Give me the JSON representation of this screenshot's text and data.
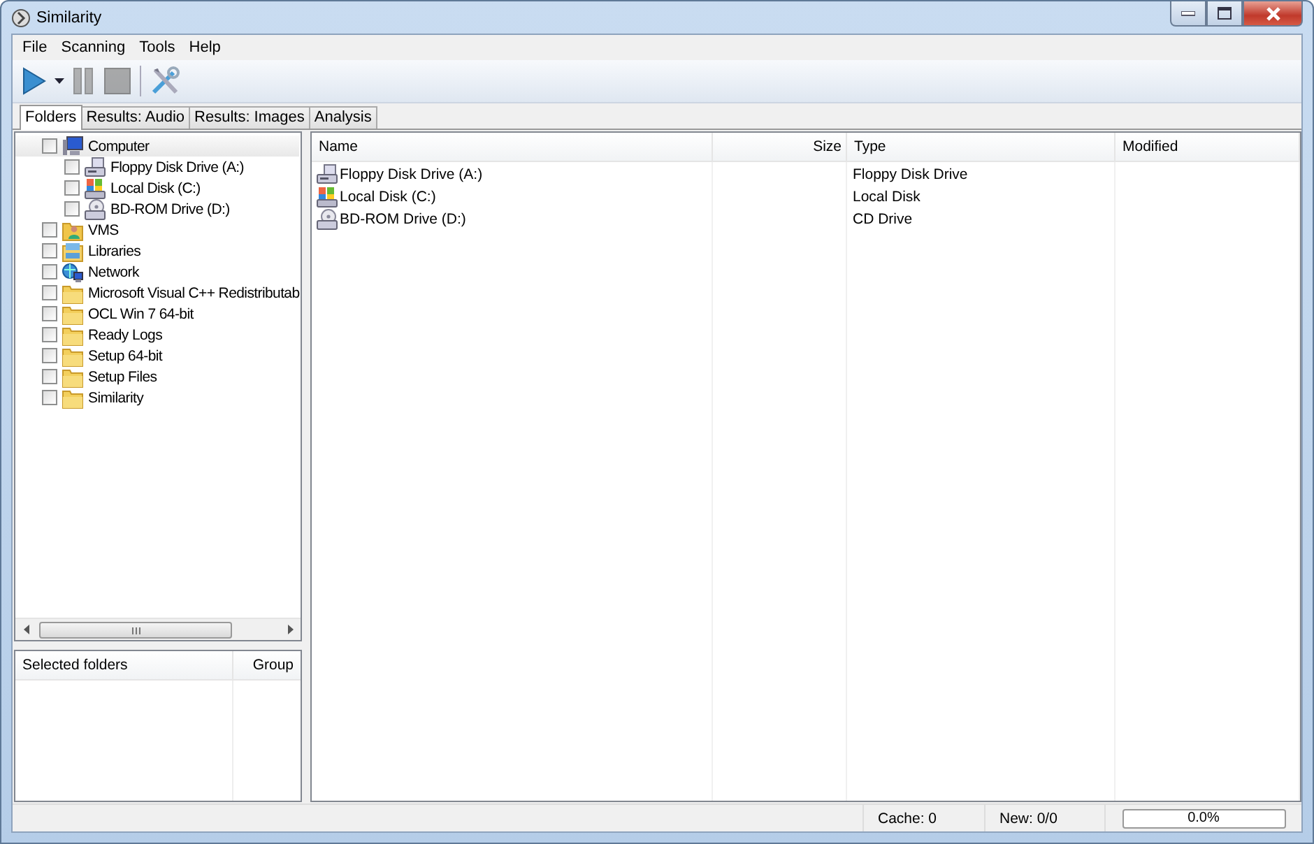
{
  "window": {
    "title": "Similarity"
  },
  "menu": [
    "File",
    "Scanning",
    "Tools",
    "Help"
  ],
  "toolbar": [
    {
      "kind": "play",
      "disabled": false
    },
    {
      "kind": "dropdown",
      "disabled": false
    },
    {
      "kind": "pause",
      "disabled": true
    },
    {
      "kind": "stop",
      "disabled": true
    },
    {
      "kind": "tools",
      "disabled": false
    }
  ],
  "tabs": [
    {
      "label": "Folders",
      "selected": true
    },
    {
      "label": "Results: Audio",
      "selected": false
    },
    {
      "label": "Results: Images",
      "selected": false
    },
    {
      "label": "Analysis",
      "selected": false
    }
  ],
  "tree": {
    "items": [
      {
        "label": "Computer",
        "kind": "computer",
        "checked": false,
        "selected": true,
        "children": [
          {
            "label": "Floppy Disk Drive (A:)",
            "kind": "floppy",
            "checked": false,
            "selected": false
          },
          {
            "label": "Local Disk (C:)",
            "kind": "disk",
            "checked": false,
            "selected": false
          },
          {
            "label": "BD-ROM Drive (D:)",
            "kind": "optical",
            "checked": false,
            "selected": false
          }
        ]
      },
      {
        "label": "VMS",
        "kind": "user-folder",
        "checked": false,
        "selected": false
      },
      {
        "label": "Libraries",
        "kind": "library",
        "checked": false,
        "selected": false
      },
      {
        "label": "Network",
        "kind": "network",
        "checked": false,
        "selected": false
      },
      {
        "label": "Microsoft Visual C++ Redistributab",
        "kind": "folder",
        "checked": false,
        "selected": false
      },
      {
        "label": "OCL Win 7 64-bit",
        "kind": "folder",
        "checked": false,
        "selected": false
      },
      {
        "label": "Ready Logs",
        "kind": "folder",
        "checked": false,
        "selected": false
      },
      {
        "label": "Setup 64-bit",
        "kind": "folder",
        "checked": false,
        "selected": false
      },
      {
        "label": "Setup Files",
        "kind": "folder",
        "checked": false,
        "selected": false
      },
      {
        "label": "Similarity",
        "kind": "folder",
        "checked": false,
        "selected": false
      }
    ]
  },
  "file_list": {
    "columns": [
      "Name",
      "Size",
      "Type",
      "Modified"
    ],
    "rows": [
      {
        "kind": "floppy",
        "name": "Floppy Disk Drive (A:)",
        "type": "Floppy Disk Drive"
      },
      {
        "kind": "disk",
        "name": "Local Disk (C:)",
        "type": "Local Disk"
      },
      {
        "kind": "optical",
        "name": "BD-ROM Drive (D:)",
        "type": "CD Drive"
      }
    ]
  },
  "selected_folders": {
    "columns": [
      "Selected folders",
      "Group"
    ]
  },
  "status_bar": {
    "cache": "Cache: 0",
    "new": "New: 0/0",
    "progress": {
      "level": 0,
      "text": "0.0%"
    }
  }
}
